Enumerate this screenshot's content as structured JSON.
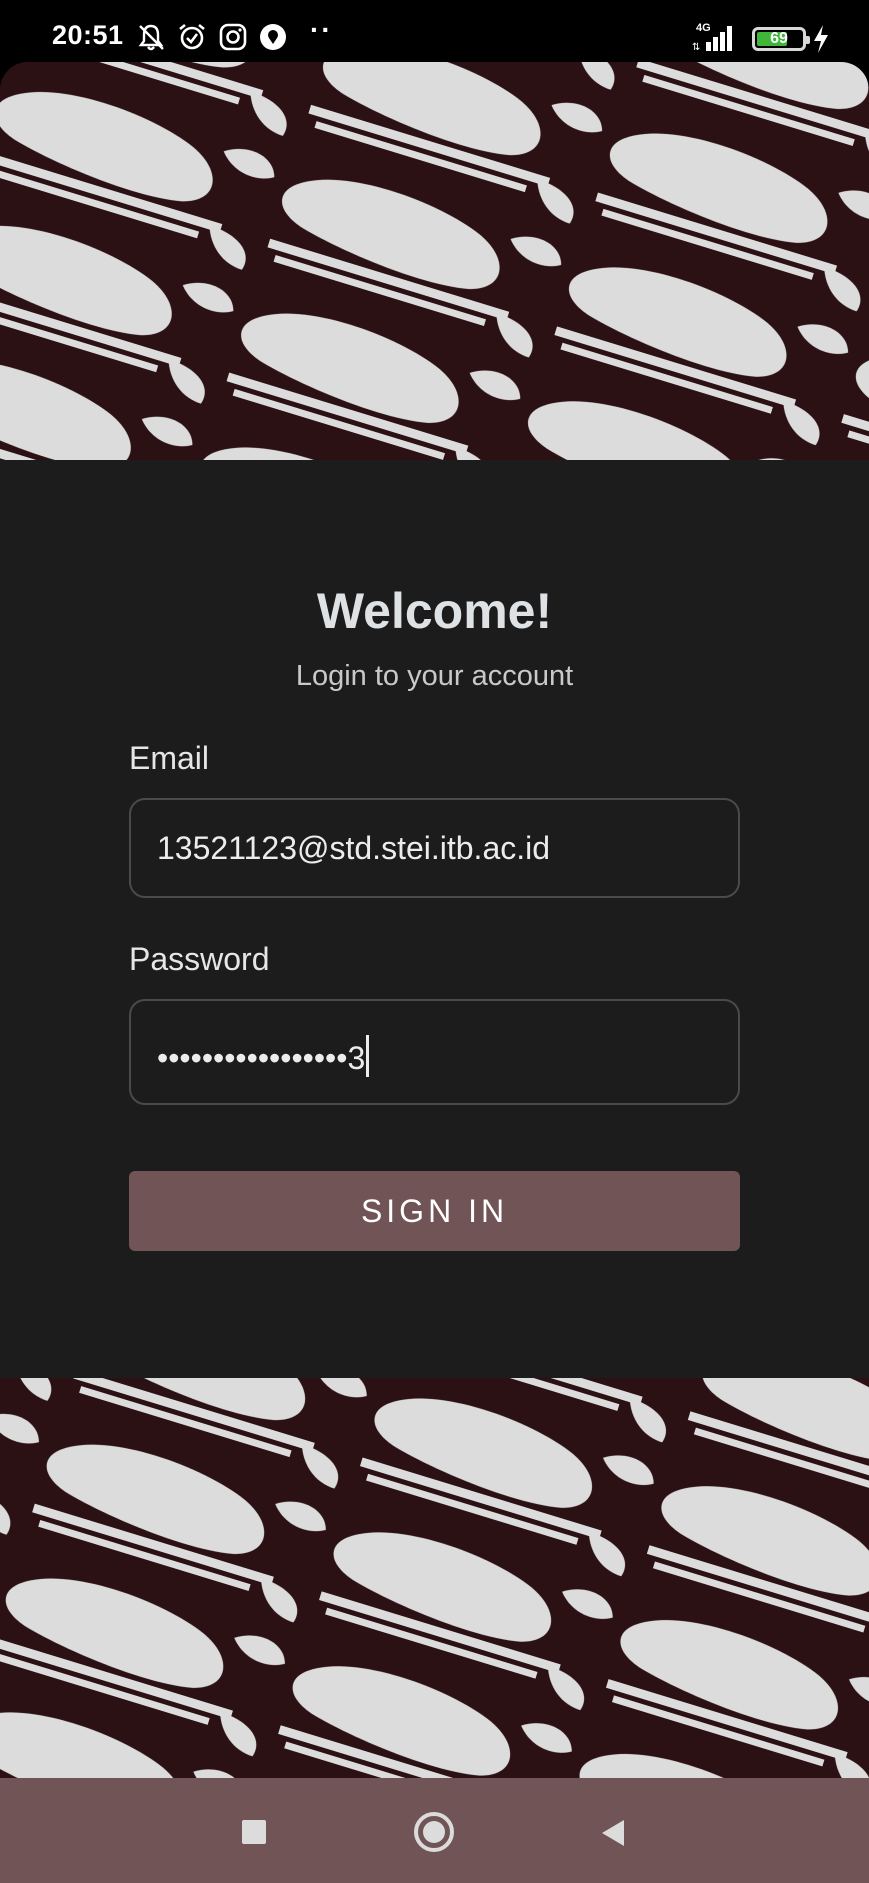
{
  "status_bar": {
    "time": "20:51",
    "network_label": "4G",
    "battery_level": "69",
    "battery_fraction": 0.69,
    "icons": [
      "mute-notification-icon",
      "alarm-icon",
      "instagram-icon",
      "gps-app-icon",
      "more-dots-icon",
      "signal-icon",
      "battery-icon",
      "charging-icon"
    ]
  },
  "login": {
    "title": "Welcome!",
    "subtitle": "Login to your account",
    "email_label": "Email",
    "email_value": "13521123@std.stei.itb.ac.id",
    "password_label": "Password",
    "password_value": "•••••••••••••••••3",
    "sign_in_label": "SIGN IN"
  },
  "nav_bar": {
    "icons": [
      "recents-square-icon",
      "home-circle-icon",
      "back-triangle-icon"
    ]
  },
  "colors": {
    "card_background": "#1c1c1c",
    "batik_dark": "#2b1014",
    "batik_light": "#dcdcdc",
    "accent": "#715456",
    "text_primary": "#dfe2e5"
  }
}
